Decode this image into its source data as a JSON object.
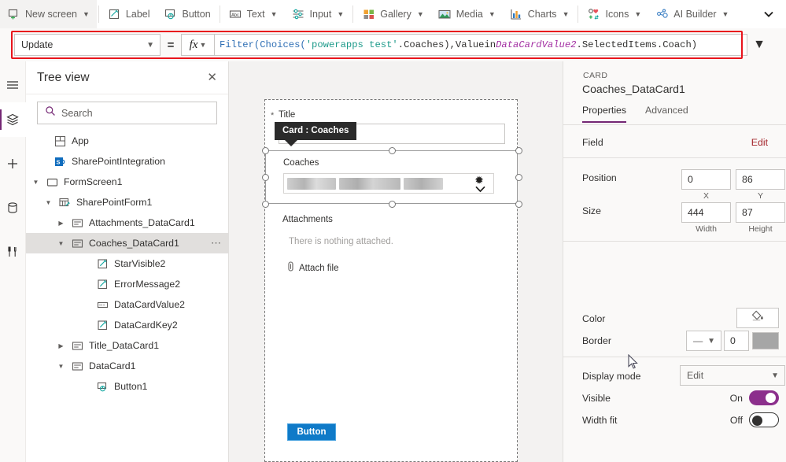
{
  "commandbar": {
    "items": [
      {
        "label": "New screen",
        "icon": "new-screen-icon",
        "caret": true
      },
      {
        "label": "Label",
        "icon": "label-icon",
        "caret": false
      },
      {
        "label": "Button",
        "icon": "button-icon",
        "caret": false
      },
      {
        "label": "Text",
        "icon": "text-icon",
        "caret": true
      },
      {
        "label": "Input",
        "icon": "input-icon",
        "caret": true
      },
      {
        "label": "Gallery",
        "icon": "gallery-icon",
        "caret": true
      },
      {
        "label": "Media",
        "icon": "media-icon",
        "caret": true
      },
      {
        "label": "Charts",
        "icon": "charts-icon",
        "caret": true
      },
      {
        "label": "Icons",
        "icon": "icons-icon",
        "caret": true
      },
      {
        "label": "AI Builder",
        "icon": "ai-builder-icon",
        "caret": true
      }
    ],
    "overflow_icon": "chevron-down-icon"
  },
  "formula_bar": {
    "property": "Update",
    "equals": "=",
    "fx_label": "fx",
    "highlight_color": "#e8141c",
    "formula_text": "Filter(Choices('powerapps test'.Coaches), Value in DataCardValue2.SelectedItems.Coach)",
    "tokens": [
      {
        "t": "Filter(",
        "k": "fn"
      },
      {
        "t": "Choices(",
        "k": "fn"
      },
      {
        "t": "'powerapps test'",
        "k": "str"
      },
      {
        "t": ".Coaches), ",
        "k": "ctl"
      },
      {
        "t": "Value",
        "k": "ctl"
      },
      {
        "t": " in ",
        "k": "ctl"
      },
      {
        "t": "DataCardValue2",
        "k": "id"
      },
      {
        "t": ".SelectedItems.Coach)",
        "k": "ctl"
      }
    ]
  },
  "rail": {
    "items": [
      {
        "name": "hamburger-menu-icon",
        "active": false
      },
      {
        "name": "tree-view-icon",
        "active": true
      },
      {
        "name": "insert-plus-icon",
        "active": false
      },
      {
        "name": "data-icon",
        "active": false
      },
      {
        "name": "tools-icon",
        "active": false
      }
    ]
  },
  "tree": {
    "title": "Tree view",
    "close_label": "✕",
    "search_placeholder": "Search",
    "search_value": "",
    "nodes": [
      {
        "label": "App",
        "icon": "app-icon",
        "indent": 0,
        "twist": "",
        "selected": false,
        "dots": false
      },
      {
        "label": "SharePointIntegration",
        "icon": "sharepoint-icon",
        "indent": 0,
        "twist": "",
        "selected": false,
        "dots": false
      },
      {
        "label": "FormScreen1",
        "icon": "screen-icon",
        "indent": 0,
        "twist": "down",
        "selected": false,
        "dots": false
      },
      {
        "label": "SharePointForm1",
        "icon": "form-icon",
        "indent": 1,
        "twist": "down",
        "selected": false,
        "dots": false
      },
      {
        "label": "Attachments_DataCard1",
        "icon": "card-icon",
        "indent": 2,
        "twist": "right",
        "selected": false,
        "dots": false
      },
      {
        "label": "Coaches_DataCard1",
        "icon": "card-icon",
        "indent": 2,
        "twist": "down",
        "selected": true,
        "dots": true
      },
      {
        "label": "StarVisible2",
        "icon": "label-ctl-icon",
        "indent": 3,
        "twist": "",
        "selected": false,
        "dots": false
      },
      {
        "label": "ErrorMessage2",
        "icon": "label-ctl-icon",
        "indent": 3,
        "twist": "",
        "selected": false,
        "dots": false
      },
      {
        "label": "DataCardValue2",
        "icon": "combobox-icon",
        "indent": 3,
        "twist": "",
        "selected": false,
        "dots": false
      },
      {
        "label": "DataCardKey2",
        "icon": "label-ctl-icon",
        "indent": 3,
        "twist": "",
        "selected": false,
        "dots": false
      },
      {
        "label": "Title_DataCard1",
        "icon": "card-icon",
        "indent": 2,
        "twist": "right",
        "selected": false,
        "dots": false
      },
      {
        "label": "DataCard1",
        "icon": "card-icon",
        "indent": 2,
        "twist": "down",
        "selected": false,
        "dots": false
      },
      {
        "label": "Button1",
        "icon": "button-ctl-icon",
        "indent": 3,
        "twist": "",
        "selected": false,
        "dots": false
      }
    ]
  },
  "canvas": {
    "title_field_label": "Title",
    "required_marker": "*",
    "title_field_value": "",
    "tooltip": "Card : Coaches",
    "coaches_label": "Coaches",
    "combobox_chips": [
      "chip-redacted-1",
      "chip-redacted-2",
      "chip-redacted-3"
    ],
    "combobox_chevron": "chevron-down-icon",
    "attachments_label": "Attachments",
    "attachments_empty": "There is nothing attached.",
    "attach_file_label": "Attach file",
    "attach_file_icon": "paperclip-icon",
    "button_label": "Button",
    "button_color": "#0f7ac8"
  },
  "properties": {
    "kind": "CARD",
    "name": "Coaches_DataCard1",
    "tabs": [
      {
        "label": "Properties",
        "active": true
      },
      {
        "label": "Advanced",
        "active": false
      }
    ],
    "field": {
      "label": "Field",
      "action": "Edit"
    },
    "position": {
      "label": "Position",
      "x": "0",
      "y": "86",
      "x_sub": "X",
      "y_sub": "Y"
    },
    "size": {
      "label": "Size",
      "width": "444",
      "height": "87",
      "width_sub": "Width",
      "height_sub": "Height"
    },
    "color": {
      "label": "Color",
      "icon": "paint-bucket-icon"
    },
    "border": {
      "label": "Border",
      "style": "—",
      "thickness": "0",
      "swatch_color": "#a6a6a6"
    },
    "display_mode": {
      "label": "Display mode",
      "value": "Edit"
    },
    "visible": {
      "label": "Visible",
      "state": "On",
      "on": true
    },
    "width_fit": {
      "label": "Width fit",
      "state": "Off",
      "on": false
    },
    "accent_color": "#742774"
  }
}
